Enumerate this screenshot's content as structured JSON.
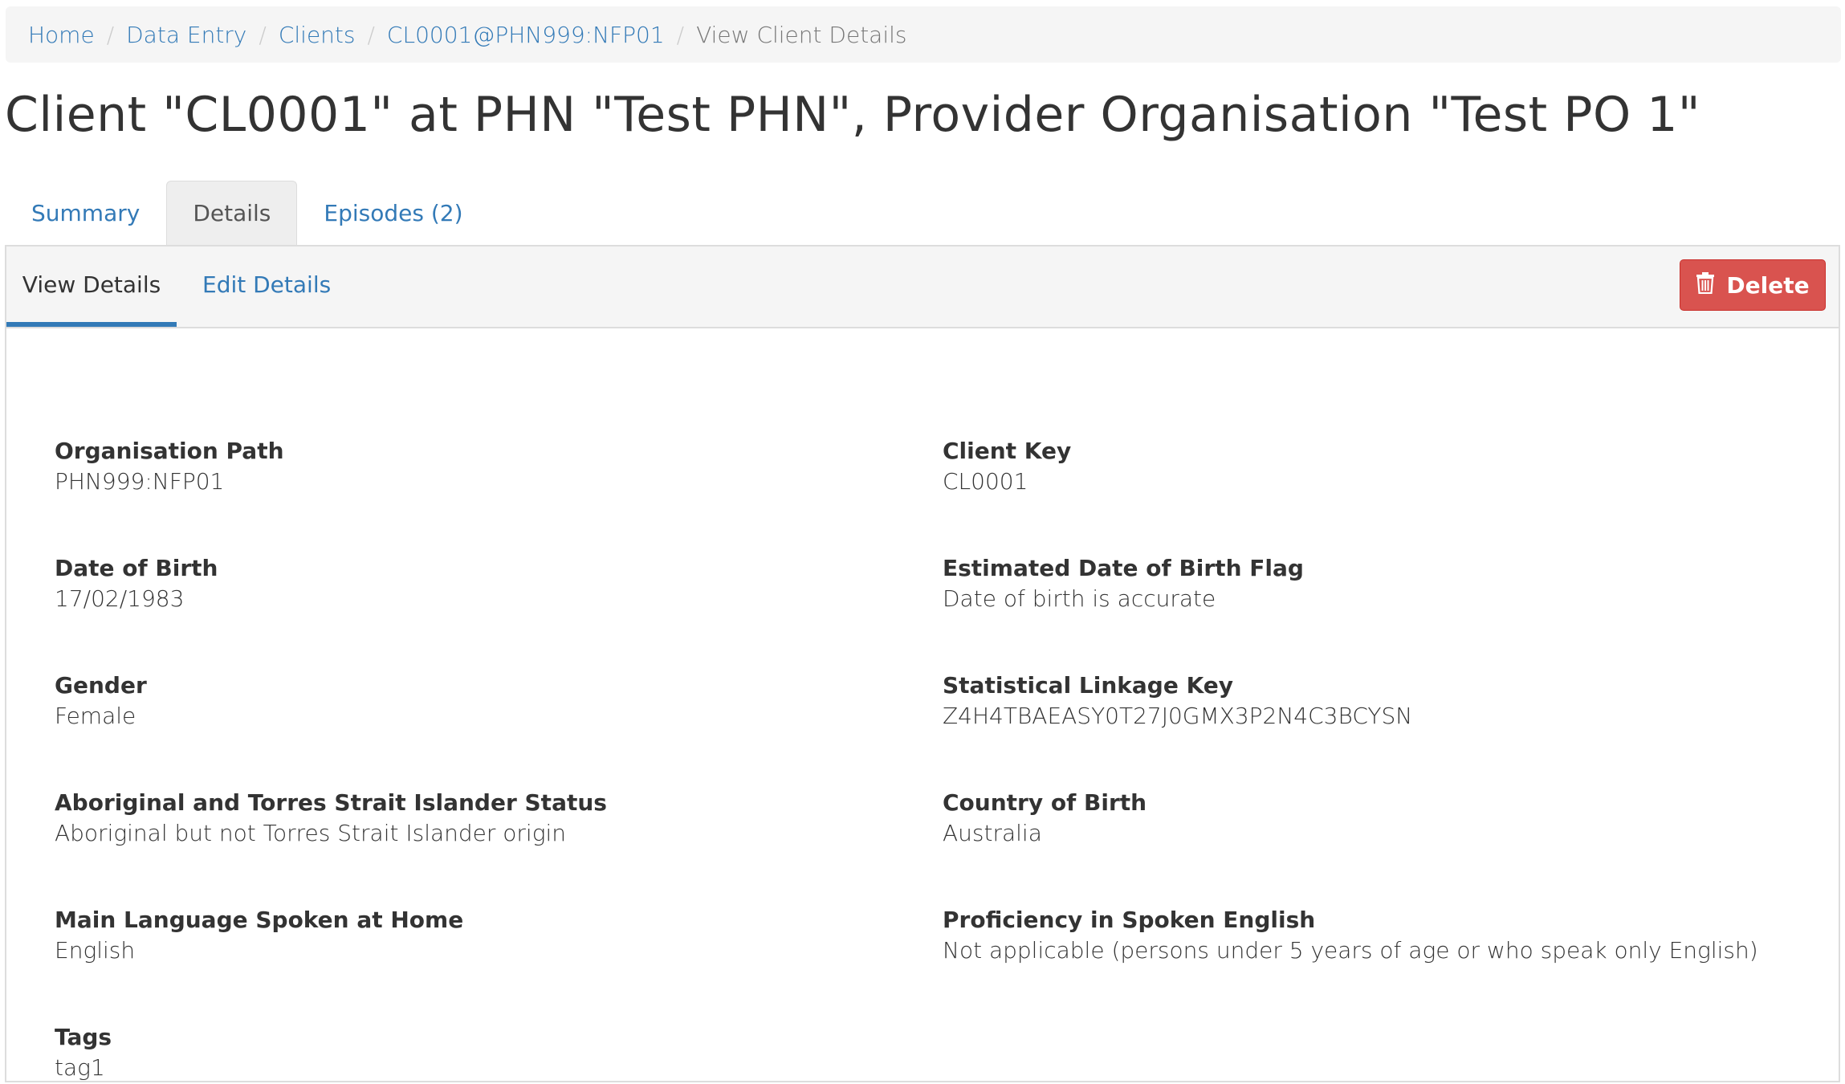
{
  "breadcrumb": {
    "items": [
      "Home",
      "Data Entry",
      "Clients",
      "CL0001@PHN999:NFP01"
    ],
    "current": "View Client Details",
    "separator": "/"
  },
  "page_title": "Client \"CL0001\" at PHN \"Test PHN\", Provider Organisation \"Test PO 1\"",
  "tabs": [
    {
      "label": "Summary",
      "active": false
    },
    {
      "label": "Details",
      "active": true
    },
    {
      "label": "Episodes (2)",
      "active": false
    }
  ],
  "subtabs": {
    "view_label": "View Details",
    "edit_label": "Edit Details"
  },
  "delete_button": {
    "label": "Delete",
    "icon": "trash-icon",
    "color": "#d9534f"
  },
  "fields": {
    "organisation_path": {
      "label": "Organisation Path",
      "value": "PHN999:NFP01"
    },
    "client_key": {
      "label": "Client Key",
      "value": "CL0001"
    },
    "date_of_birth": {
      "label": "Date of Birth",
      "value": "17/02/1983"
    },
    "estimated_dob_flag": {
      "label": "Estimated Date of Birth Flag",
      "value": "Date of birth is accurate"
    },
    "gender": {
      "label": "Gender",
      "value": "Female"
    },
    "slk": {
      "label": "Statistical Linkage Key",
      "value": "Z4H4TBAEASY0T27J0GMX3P2N4C3BCYSN"
    },
    "atsi_status": {
      "label": "Aboriginal and Torres Strait Islander Status",
      "value": "Aboriginal but not Torres Strait Islander origin"
    },
    "country_of_birth": {
      "label": "Country of Birth",
      "value": "Australia"
    },
    "main_language": {
      "label": "Main Language Spoken at Home",
      "value": "English"
    },
    "english_proficiency": {
      "label": "Proficiency in Spoken English",
      "value": "Not applicable (persons under 5 years of age or who speak only English)"
    },
    "tags": {
      "label": "Tags",
      "value": "tag1"
    }
  },
  "colors": {
    "link": "#337ab7",
    "danger": "#d9534f",
    "breadcrumb_bg": "#f5f5f5"
  }
}
